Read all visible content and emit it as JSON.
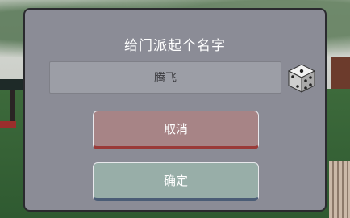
{
  "dialog": {
    "title": "给门派起个名字",
    "name_value": "腾飞",
    "dice_icon": "dice-icon",
    "cancel_label": "取消",
    "confirm_label": "确定"
  },
  "colors": {
    "dialog_bg": "#8b8c96",
    "cancel_bg": "#a78486",
    "cancel_accent": "#9a3a38",
    "confirm_bg": "#98aea8",
    "confirm_accent": "#4b5d76"
  }
}
